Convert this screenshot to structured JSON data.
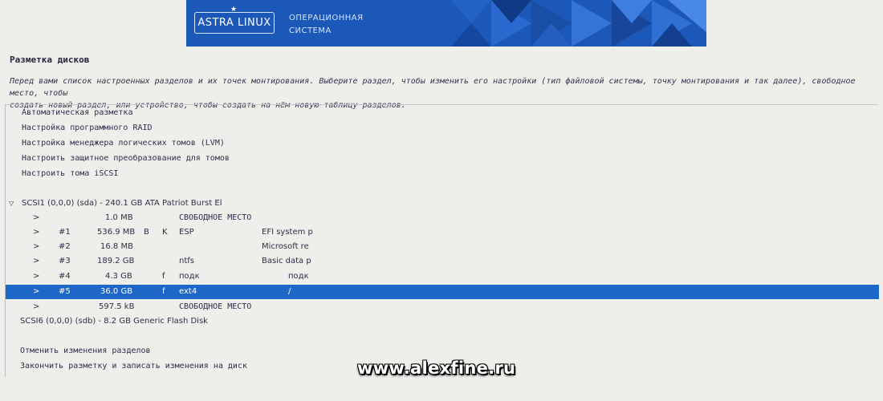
{
  "banner": {
    "logo_text": "ASTRA LINUX",
    "logo_star": "★",
    "subtitle_line1": "ОПЕРАЦИОННАЯ",
    "subtitle_line2": "СИСТЕМА",
    "color": "#1c58b8"
  },
  "page": {
    "title": "Разметка дисков",
    "intro_line1": "Перед вами список настроенных разделов и их точек монтирования. Выберите раздел, чтобы изменить его настройки (тип файловой системы, точку монтирования и так далее), свободное место, чтобы",
    "intro_line2": "создать новый раздел, или устройство, чтобы создать на нём новую таблицу разделов."
  },
  "menu": [
    {
      "label": "Автоматическая разметка"
    },
    {
      "label": "Настройка программного RAID"
    },
    {
      "label": "Настройка менеджера логических томов (LVM)"
    },
    {
      "label": "Настроить защитное преобразование для томов"
    },
    {
      "label": "Настроить тома iSCSI"
    }
  ],
  "disk1": {
    "toggle_icon": "▽",
    "label": "SCSI1 (0,0,0) (sda) - 240.1 GB ATA Patriot Burst El"
  },
  "partitions": [
    {
      "arrow": ">",
      "num": "",
      "size": "1.0 MB",
      "flag1": "",
      "flag2": "",
      "fs": "СВОБОДНОЕ МЕСТО",
      "name": "",
      "mount": ""
    },
    {
      "arrow": ">",
      "num": "#1",
      "size": "536.9 MB",
      "flag1": "B",
      "flag2": "K",
      "fs": "ESP",
      "name": "EFI system p",
      "mount": ""
    },
    {
      "arrow": ">",
      "num": "#2",
      "size": "16.8 MB",
      "flag1": "",
      "flag2": "",
      "fs": "",
      "name": "Microsoft re",
      "mount": ""
    },
    {
      "arrow": ">",
      "num": "#3",
      "size": "189.2 GB",
      "flag1": "",
      "flag2": "",
      "fs": "ntfs",
      "name": "Basic data p",
      "mount": ""
    },
    {
      "arrow": ">",
      "num": "#4",
      "size": "4.3 GB",
      "flag1": "f",
      "flag2": "",
      "fs": "подк",
      "name": "",
      "mount": "подк"
    },
    {
      "arrow": ">",
      "num": "#5",
      "size": "36.0 GB",
      "flag1": "f",
      "flag2": "",
      "fs": "ext4",
      "name": "",
      "mount": "/"
    },
    {
      "arrow": ">",
      "num": "",
      "size": "597.5 kB",
      "flag1": "",
      "flag2": "",
      "fs": "СВОБОДНОЕ МЕСТО",
      "name": "",
      "mount": ""
    }
  ],
  "disk2": {
    "label": "SCSI6 (0,0,0) (sdb) - 8.2 GB Generic Flash Disk"
  },
  "actions": {
    "undo": "Отменить изменения разделов",
    "finish": "Закончить разметку и записать изменения на диск"
  },
  "watermark": "www.alexfine.ru",
  "colors": {
    "selection": "#1e66c8",
    "background": "#eeeeea"
  }
}
